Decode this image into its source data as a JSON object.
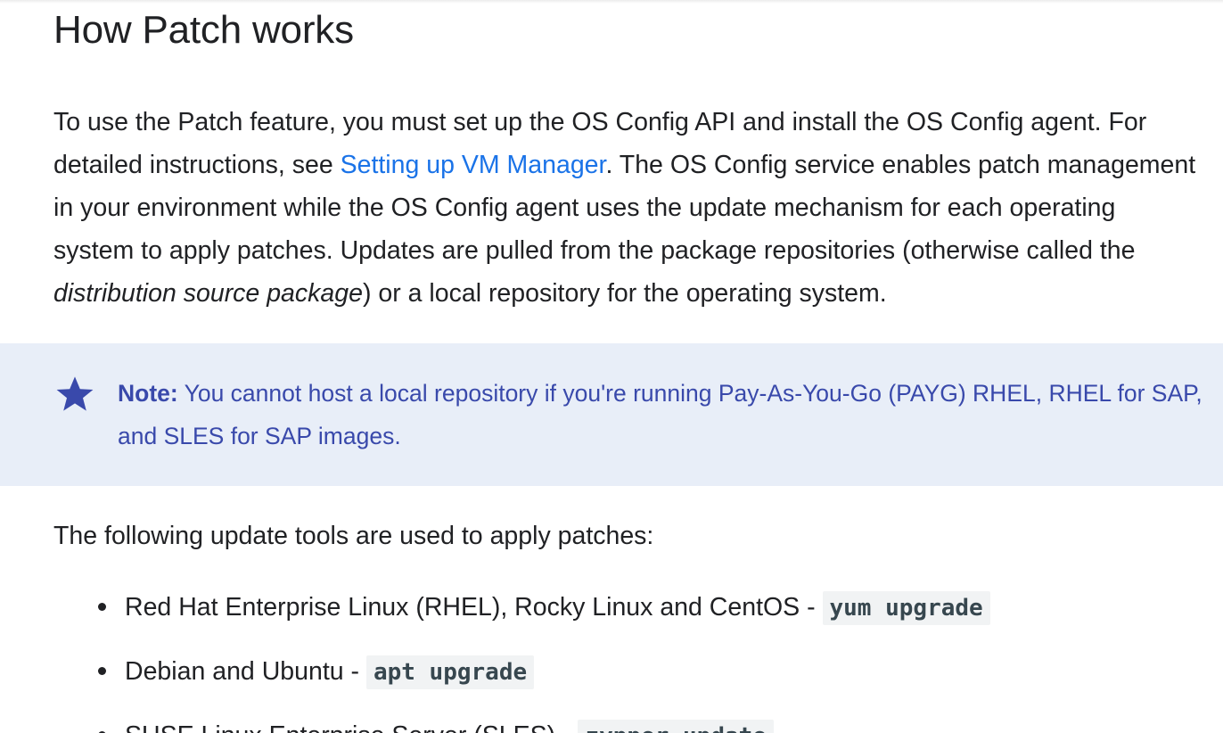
{
  "heading": "How Patch works",
  "intro": {
    "line1": "To use the Patch feature, you must set up the OS Config API and install the OS Config agent. For",
    "line2_before": "detailed instructions, see ",
    "line2_link": "Setting up VM Manager",
    "line2_after": ". The OS Config service enables patch management",
    "line3": "in your environment while the OS Config agent uses the update mechanism for each operating",
    "line4": "system to apply patches. Updates are pulled from the package repositories (otherwise called the",
    "line5_em": "distribution source package",
    "line5_after": ") or a local repository for the operating system."
  },
  "note": {
    "icon": "star-icon",
    "label": "Note:",
    "line1": " You cannot host a local repository if you're running Pay-As-You-Go (PAYG) RHEL, RHEL for SAP,",
    "line2": "and SLES for SAP images."
  },
  "tools_intro": "The following update tools are used to apply patches:",
  "tools": [
    {
      "os": "Red Hat Enterprise Linux (RHEL), Rocky Linux and CentOS - ",
      "command": "yum upgrade"
    },
    {
      "os": "Debian and Ubuntu - ",
      "command": "apt upgrade"
    },
    {
      "os": "SUSE Linux Enterprise Server (SLES) - ",
      "command": "zypper update"
    }
  ],
  "colors": {
    "link": "#1a73e8",
    "note_background": "#e8eef8",
    "note_text": "#3949ab",
    "body_text": "#202124"
  }
}
